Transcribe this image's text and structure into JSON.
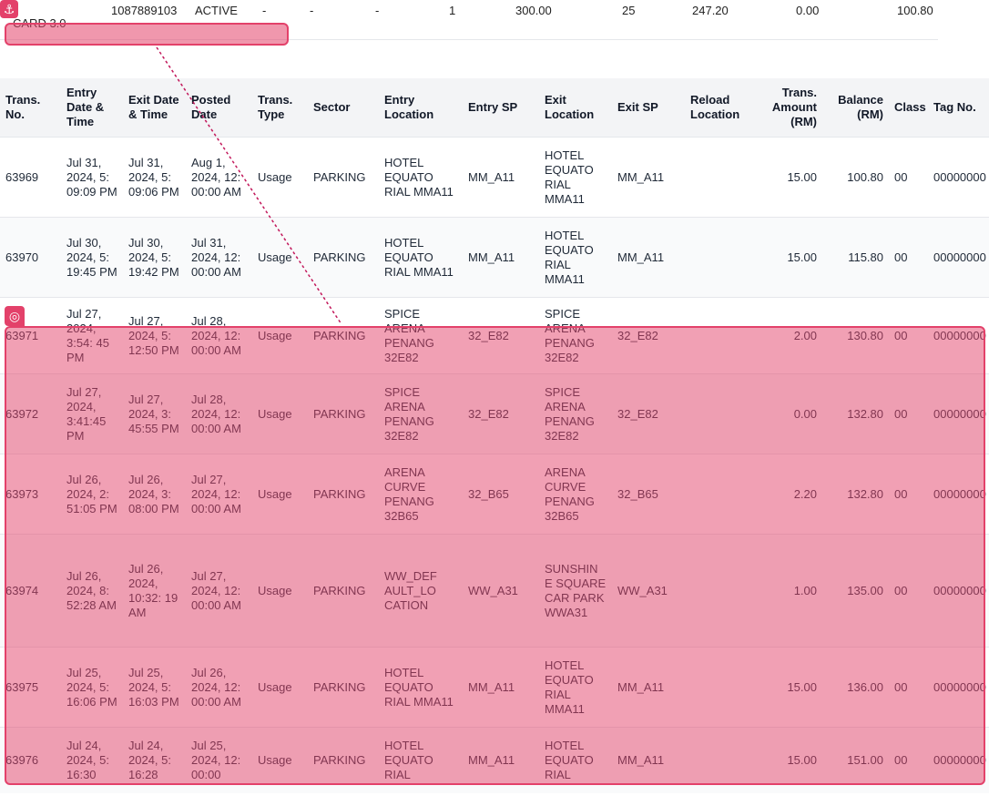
{
  "card_summary": {
    "card_name": "CARD 3.0",
    "card_number": "1087889103",
    "status": "ACTIVE",
    "col_a": "-",
    "col_b": "-",
    "col_c": "-",
    "col_d": "1",
    "col_e": "300.00",
    "col_f": "25",
    "col_g": "247.20",
    "col_h": "0.00",
    "col_i": "100.80"
  },
  "table": {
    "headers": {
      "trans_no": "Trans. No.",
      "entry_dt": "Entry Date & Time",
      "exit_dt": "Exit Date & Time",
      "posted": "Posted Date",
      "type": "Trans. Type",
      "sector": "Sector",
      "entry_loc": "Entry Location",
      "entry_sp": "Entry SP",
      "exit_loc": "Exit Location",
      "exit_sp": "Exit SP",
      "reload": "Reload Location",
      "amount": "Trans. Amount (RM)",
      "balance": "Balance (RM)",
      "class": "Class",
      "tag": "Tag No."
    },
    "rows": [
      {
        "no": "63969",
        "entry": "Jul 31, 2024, 5: 09:09 PM",
        "exit": "Jul 31, 2024, 5: 09:06 PM",
        "posted": "Aug 1, 2024, 12: 00:00 AM",
        "type": "Usage",
        "sector": "PARKING",
        "entry_loc": "HOTEL EQUATO RIAL MMA11",
        "entry_sp": "MM_A11",
        "exit_loc": "HOTEL EQUATO RIAL MMA11",
        "exit_sp": "MM_A11",
        "reload": "",
        "amount": "15.00",
        "balance": "100.80",
        "class": "00",
        "tag": "00000000"
      },
      {
        "no": "63970",
        "entry": "Jul 30, 2024, 5: 19:45 PM",
        "exit": "Jul 30, 2024, 5: 19:42 PM",
        "posted": "Jul 31, 2024, 12: 00:00 AM",
        "type": "Usage",
        "sector": "PARKING",
        "entry_loc": "HOTEL EQUATO RIAL MMA11",
        "entry_sp": "MM_A11",
        "exit_loc": "HOTEL EQUATO RIAL MMA11",
        "exit_sp": "MM_A11",
        "reload": "",
        "amount": "15.00",
        "balance": "115.80",
        "class": "00",
        "tag": "00000000"
      },
      {
        "no": "63971",
        "entry": "Jul 27, 2024, 3:54: 45 PM",
        "exit": "Jul 27, 2024, 5: 12:50 PM",
        "posted": "Jul 28, 2024, 12: 00:00 AM",
        "type": "Usage",
        "sector": "PARKING",
        "entry_loc": "SPICE ARENA PENANG 32E82",
        "entry_sp": "32_E82",
        "exit_loc": "SPICE ARENA PENANG 32E82",
        "exit_sp": "32_E82",
        "reload": "",
        "amount": "2.00",
        "balance": "130.80",
        "class": "00",
        "tag": "00000000"
      },
      {
        "no": "63972",
        "entry": "Jul 27, 2024, 3:41:45 PM",
        "exit": "Jul 27, 2024, 3: 45:55 PM",
        "posted": "Jul 28, 2024, 12: 00:00 AM",
        "type": "Usage",
        "sector": "PARKING",
        "entry_loc": "SPICE ARENA PENANG 32E82",
        "entry_sp": "32_E82",
        "exit_loc": "SPICE ARENA PENANG 32E82",
        "exit_sp": "32_E82",
        "reload": "",
        "amount": "0.00",
        "balance": "132.80",
        "class": "00",
        "tag": "00000000"
      },
      {
        "no": "63973",
        "entry": "Jul 26, 2024, 2: 51:05 PM",
        "exit": "Jul 26, 2024, 3: 08:00 PM",
        "posted": "Jul 27, 2024, 12: 00:00 AM",
        "type": "Usage",
        "sector": "PARKING",
        "entry_loc": "ARENA CURVE PENANG 32B65",
        "entry_sp": "32_B65",
        "exit_loc": "ARENA CURVE PENANG 32B65",
        "exit_sp": "32_B65",
        "reload": "",
        "amount": "2.20",
        "balance": "132.80",
        "class": "00",
        "tag": "00000000"
      },
      {
        "no": "63974",
        "entry": "Jul 26, 2024, 8: 52:28 AM",
        "exit": "Jul 26, 2024, 10:32: 19 AM",
        "posted": "Jul 27, 2024, 12: 00:00 AM",
        "type": "Usage",
        "sector": "PARKING",
        "entry_loc": "WW_DEF AULT_LO CATION",
        "entry_sp": "WW_A31",
        "exit_loc": "SUNSHIN E SQUARE CAR PARK WWA31",
        "exit_sp": "WW_A31",
        "reload": "",
        "amount": "1.00",
        "balance": "135.00",
        "class": "00",
        "tag": "00000000"
      },
      {
        "no": "63975",
        "entry": "Jul 25, 2024, 5: 16:06 PM",
        "exit": "Jul 25, 2024, 5: 16:03 PM",
        "posted": "Jul 26, 2024, 12: 00:00 AM",
        "type": "Usage",
        "sector": "PARKING",
        "entry_loc": "HOTEL EQUATO RIAL MMA11",
        "entry_sp": "MM_A11",
        "exit_loc": "HOTEL EQUATO RIAL MMA11",
        "exit_sp": "MM_A11",
        "reload": "",
        "amount": "15.00",
        "balance": "136.00",
        "class": "00",
        "tag": "00000000"
      },
      {
        "no": "63976",
        "entry": "Jul 24, 2024, 5: 16:30",
        "exit": "Jul 24, 2024, 5: 16:28",
        "posted": "Jul 25, 2024, 12: 00:00",
        "type": "Usage",
        "sector": "PARKING",
        "entry_loc": "HOTEL EQUATO RIAL",
        "entry_sp": "MM_A11",
        "exit_loc": "HOTEL EQUATO RIAL",
        "exit_sp": "MM_A11",
        "reload": "",
        "amount": "15.00",
        "balance": "151.00",
        "class": "00",
        "tag": "00000000"
      }
    ]
  },
  "annotation": {
    "anchor_icon": "anchor-icon",
    "target_icon": "target-icon",
    "color": "#e3416a"
  }
}
